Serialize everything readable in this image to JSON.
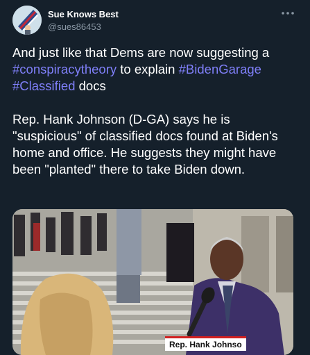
{
  "tweet": {
    "author_name": "Sue Knows Best",
    "author_handle": "@sues86453",
    "avatar_icon": "avatar-flag-icon",
    "more_icon": "more-options-icon",
    "line1_before": "And just like that Dems are now suggesting a ",
    "hashtag_conspiracy": "#conspiracytheory",
    "line1_middle": " to explain ",
    "hashtag_garage": "#BidenGarage",
    "hashtag_classified": "#Classified",
    "line1_after": " docs",
    "paragraph2": "Rep. Hank Johnson (D-GA) says he is \"suspicious\" of classified docs found at Biden's home and office. He suggests they might have been \"planted\" there to take Biden down.",
    "video_caption": "Rep. Hank Johnso"
  },
  "colors": {
    "background": "#15202b",
    "hashtag": "#7f7ff8",
    "secondary_text": "#8b98a5"
  }
}
